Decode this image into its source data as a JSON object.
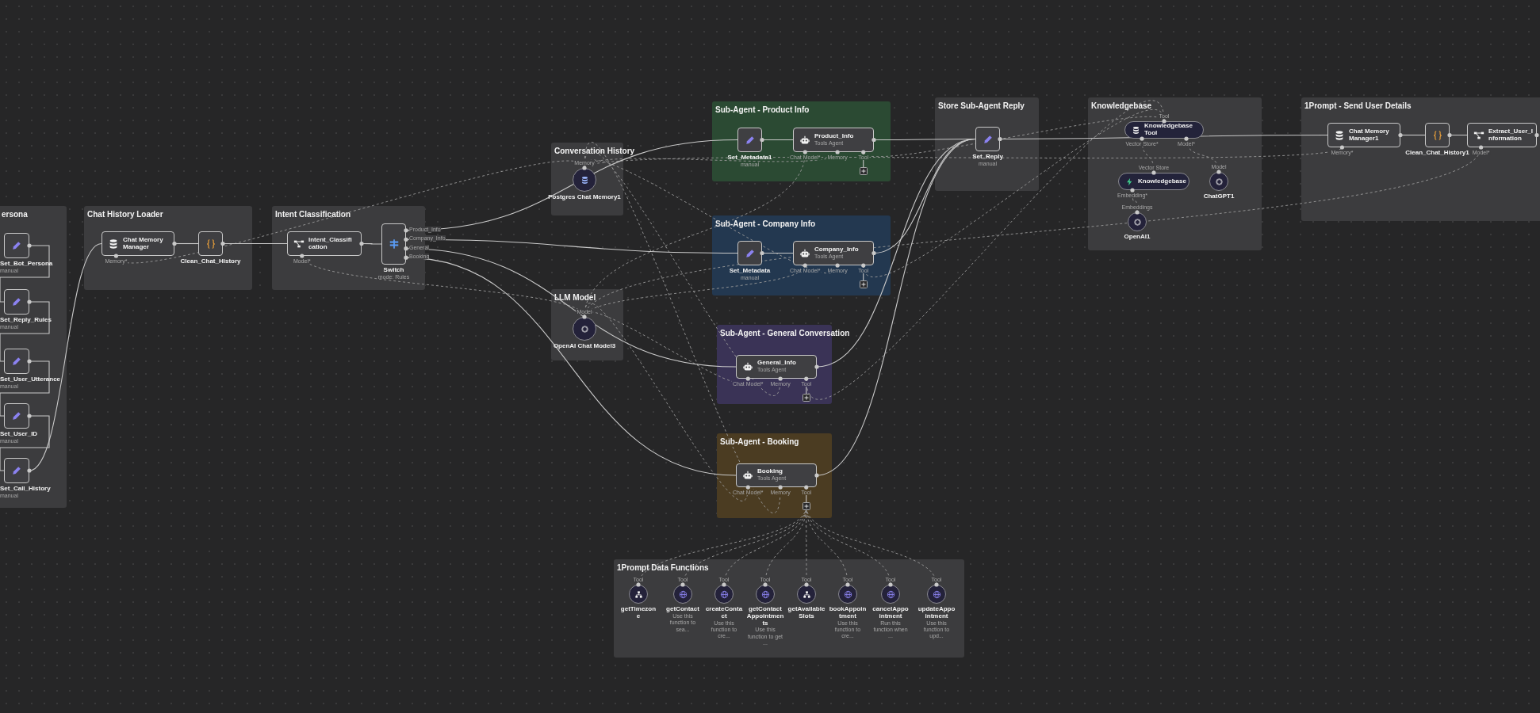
{
  "groups": [
    {
      "title": "ersona",
      "color": "#3c3c3e",
      "nodes": [
        {
          "kind": "set",
          "name": "Set_Bot_Persona",
          "subtitle": "manual"
        },
        {
          "kind": "set",
          "name": "Set_Reply_Rules",
          "subtitle": "manual"
        },
        {
          "kind": "set",
          "name": "Set_User_Utterance",
          "subtitle": "manual"
        },
        {
          "kind": "set",
          "name": "Set_User_ID",
          "subtitle": "manual"
        },
        {
          "kind": "set",
          "name": "Set_Call_History",
          "subtitle": "manual"
        }
      ]
    },
    {
      "title": "Chat History Loader",
      "color": "#3c3c3e",
      "nodes": [
        {
          "kind": "memory-manager",
          "name": "Chat Memory Manager",
          "ports": [
            "Memory*"
          ]
        },
        {
          "kind": "code",
          "name": "Clean_Chat_History"
        }
      ]
    },
    {
      "title": "Intent Classification",
      "color": "#3c3c3e",
      "nodes": [
        {
          "kind": "classifier",
          "name": "Intent_Classification",
          "ports": [
            "Model*"
          ]
        },
        {
          "kind": "switch",
          "name": "Switch",
          "subtitle": "mode: Rules",
          "outputs": [
            "Product_Info",
            "Company_Info",
            "General",
            "Booking"
          ]
        }
      ]
    },
    {
      "title": "Conversation History",
      "color": "#3c3c3e",
      "nodes": [
        {
          "kind": "chat-memory",
          "name": "Postgres Chat Memory1",
          "top_port": "Memory"
        }
      ]
    },
    {
      "title": "LLM Model",
      "color": "#3c3c3e",
      "nodes": [
        {
          "kind": "chat-model",
          "name": "OpenAI Chat Model3",
          "top_port": "Model"
        }
      ]
    },
    {
      "title": "Sub-Agent - Product Info",
      "color": "#2b4a33",
      "nodes": [
        {
          "kind": "set",
          "name": "Set_Metadata1",
          "subtitle": "manual"
        },
        {
          "kind": "agent",
          "name": "Product_Info",
          "subtitle": "Tools Agent",
          "ports": [
            "Chat Model*",
            "Memory",
            "Tool"
          ]
        }
      ]
    },
    {
      "title": "Sub-Agent - Company Info",
      "color": "#233850",
      "nodes": [
        {
          "kind": "set",
          "name": "Set_Metadata",
          "subtitle": "manual"
        },
        {
          "kind": "agent",
          "name": "Company_Info",
          "subtitle": "Tools Agent",
          "ports": [
            "Chat Model*",
            "Memory",
            "Tool"
          ]
        }
      ]
    },
    {
      "title": "Sub-Agent - General Conversation",
      "color": "#3a3356",
      "nodes": [
        {
          "kind": "agent",
          "name": "General_Info",
          "subtitle": "Tools Agent",
          "ports": [
            "Chat Model*",
            "Memory",
            "Tool"
          ]
        }
      ]
    },
    {
      "title": "Sub-Agent - Booking",
      "color": "#4b3c22",
      "nodes": [
        {
          "kind": "agent",
          "name": "Booking",
          "subtitle": "Tools Agent",
          "ports": [
            "Chat Model*",
            "Memory",
            "Tool"
          ]
        }
      ]
    },
    {
      "title": "Store Sub-Agent Reply",
      "color": "#3c3c3e",
      "nodes": [
        {
          "kind": "set",
          "name": "Set_Reply",
          "subtitle": "manual"
        }
      ]
    },
    {
      "title": "Knowledgebase",
      "color": "#3c3c3e",
      "nodes": [
        {
          "kind": "vector-tool",
          "name": "Knowledgebase Tool",
          "top_port": "Tool",
          "ports": [
            "Vector Store*",
            "Model*"
          ]
        },
        {
          "kind": "vector-store",
          "name": "Knowledgebase",
          "top_port": "Vector Store",
          "ports": [
            "Embedding*"
          ]
        },
        {
          "kind": "chat-model",
          "name": "ChatGPT1",
          "top_port": "Model"
        },
        {
          "kind": "chat-model",
          "name": "OpenAI1",
          "top_port": "Embeddings"
        }
      ]
    },
    {
      "title": "1Prompt - Send User Details",
      "color": "#3c3c3e",
      "nodes": [
        {
          "kind": "memory-manager",
          "name": "Chat Memory Manager1",
          "ports": [
            "Memory*"
          ]
        },
        {
          "kind": "code",
          "name": "Clean_Chat_History1"
        },
        {
          "kind": "classifier",
          "name": "Extract_User_Information",
          "ports": [
            "Model*"
          ]
        }
      ]
    },
    {
      "title": "1Prompt Data Functions",
      "color": "#3c3c3e",
      "nodes": [
        {
          "kind": "workflow-tool",
          "name": "getTimezone",
          "top_port": "Tool"
        },
        {
          "kind": "http-tool",
          "name": "getContact",
          "top_port": "Tool",
          "description": "Use this function to sea..."
        },
        {
          "kind": "http-tool",
          "name": "createContact",
          "top_port": "Tool",
          "description": "Use this function to cre..."
        },
        {
          "kind": "http-tool",
          "name": "getContactAppointments",
          "top_port": "Tool",
          "description": "Use this function to get ..."
        },
        {
          "kind": "workflow-tool",
          "name": "getAvailableSlots",
          "top_port": "Tool"
        },
        {
          "kind": "http-tool",
          "name": "bookAppointment",
          "top_port": "Tool",
          "description": "Use this function to cre..."
        },
        {
          "kind": "http-tool",
          "name": "cancelAppointment",
          "top_port": "Tool",
          "description": "Run this function when ..."
        },
        {
          "kind": "http-tool",
          "name": "updateAppointment",
          "top_port": "Tool",
          "description": "Use this function to upd..."
        }
      ]
    }
  ]
}
